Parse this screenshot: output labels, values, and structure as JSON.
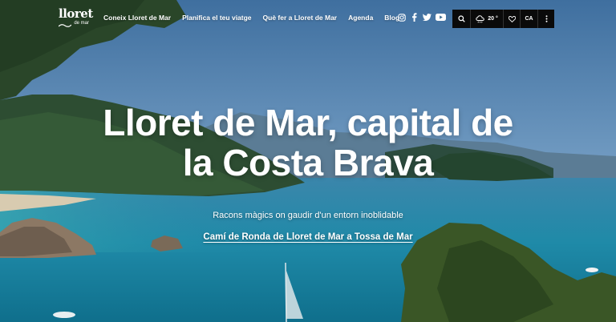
{
  "header": {
    "logo": {
      "name": "lloret",
      "sub": "de mar"
    },
    "nav": [
      {
        "label": "Coneix Lloret de Mar"
      },
      {
        "label": "Planifica el teu viatge"
      },
      {
        "label": "Què fer a Lloret de Mar"
      },
      {
        "label": "Agenda"
      },
      {
        "label": "Blog"
      }
    ],
    "social": [
      "instagram-icon",
      "facebook-icon",
      "twitter-icon",
      "youtube-icon"
    ],
    "toolbar": {
      "search_icon": "search-icon",
      "weather_temp": "20 °",
      "favorites_icon": "heart-icon",
      "language": "CA",
      "more_icon": "more-vertical-icon"
    }
  },
  "hero": {
    "title_line1": "Lloret de Mar, capital de",
    "title_line2": "la Costa Brava",
    "subtitle": "Racons màgics on gaudir d'un entorn inoblidable",
    "link": "Camí de Ronda de Lloret de Mar a Tossa de Mar"
  },
  "colors": {
    "toolbar_bg": "#0a0a0a",
    "sea": "#1d7fa6",
    "sky": "#6d98c2"
  }
}
